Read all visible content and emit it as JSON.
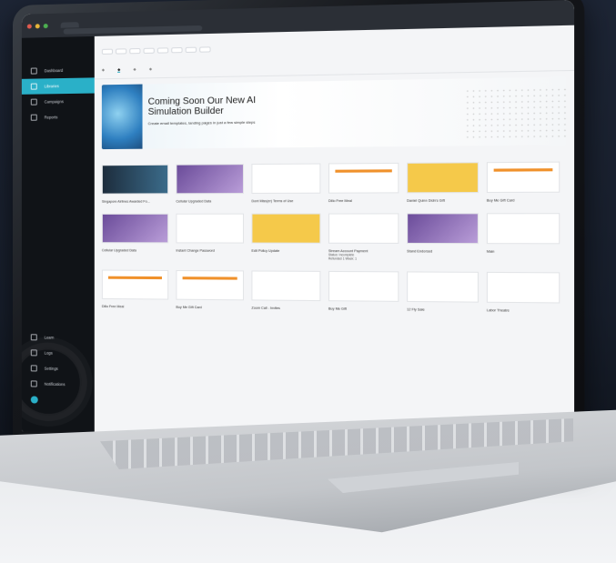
{
  "sidebar": {
    "items": [
      {
        "label": "Dashboard",
        "icon": "home-icon"
      },
      {
        "label": "Libraries",
        "icon": "book-icon"
      },
      {
        "label": "Campaigns",
        "icon": "megaphone-icon"
      },
      {
        "label": "Reports",
        "icon": "chart-icon"
      }
    ],
    "bottom": [
      {
        "label": "Learn"
      },
      {
        "label": "Logs"
      },
      {
        "label": "Settings"
      },
      {
        "label": "Notifications"
      }
    ],
    "accent": "#2ab0c8"
  },
  "banner": {
    "title": "Coming Soon Our New AI Simulation Builder",
    "subtitle": "Create email templates, landing pages in just a few simple steps"
  },
  "sections": [
    {
      "cards": [
        {
          "label": "Singapore Airlines Awarded Fo..."
        },
        {
          "label": "Cellular Upgraded Data"
        },
        {
          "label": "Dont Miss(er) Terms of Use"
        },
        {
          "label": "Dillo Free Meal"
        },
        {
          "label": "Daniel Quinn Didn's Gift"
        },
        {
          "label": "Buy Me Gift Card"
        }
      ]
    },
    {
      "cards": [
        {
          "label": "Cellular Upgraded Data"
        },
        {
          "label": "Instant Change Password"
        },
        {
          "label": "Edit Policy Update"
        },
        {
          "label": "Stream Account Payment",
          "extra": [
            "Status: Incomplete",
            "Refunded 1 Week: 1"
          ]
        },
        {
          "label": "Stand Endorsed"
        },
        {
          "label": "Main"
        }
      ]
    },
    {
      "cards": [
        {
          "label": "Dillo Free Meal"
        },
        {
          "label": "Buy Me Gift Card"
        },
        {
          "label": "Zoom Call - Invites"
        },
        {
          "label": "Buy Me Gift"
        },
        {
          "label": "12 Fly Sale"
        },
        {
          "label": "Labor Theatre"
        }
      ]
    }
  ]
}
